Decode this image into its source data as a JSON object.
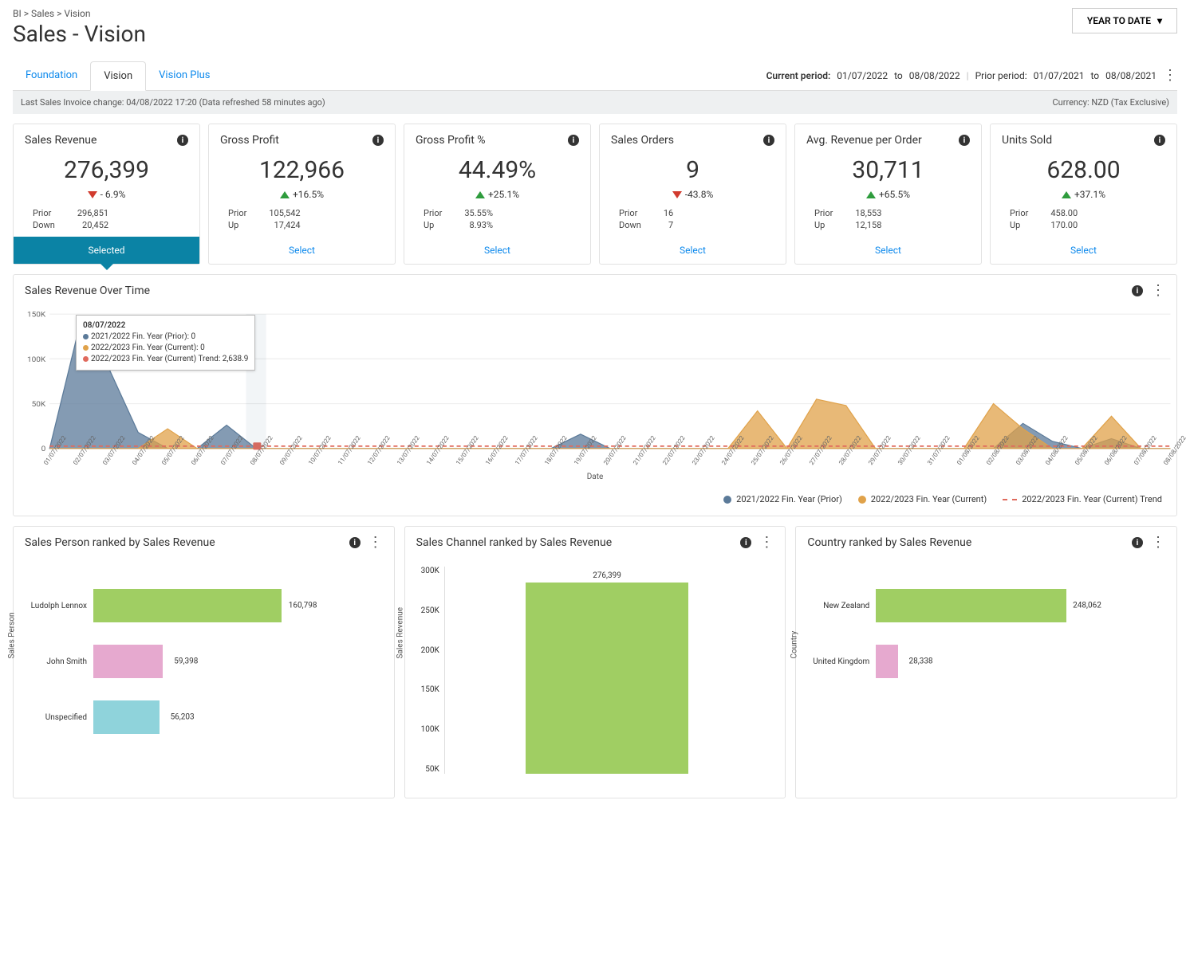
{
  "breadcrumb": "BI > Sales > Vision",
  "title": "Sales - Vision",
  "period_selector": "YEAR TO DATE",
  "tabs": [
    {
      "label": "Foundation",
      "active": false
    },
    {
      "label": "Vision",
      "active": true
    },
    {
      "label": "Vision Plus",
      "active": false
    }
  ],
  "periods": {
    "current_lbl": "Current period:",
    "current_from": "01/07/2022",
    "to_txt": "to",
    "current_to": "08/08/2022",
    "prior_lbl": "Prior period:",
    "prior_from": "01/07/2021",
    "prior_to": "08/08/2021"
  },
  "info_left": "Last Sales Invoice change: 04/08/2022 17:20 (Data refreshed 58 minutes ago)",
  "info_right": "Currency:  NZD (Tax Exclusive)",
  "kpi": [
    {
      "title": "Sales Revenue",
      "value": "276,399",
      "dir": "down",
      "chg": "- 6.9%",
      "r1l": "Prior",
      "r1v": "296,851",
      "r2l": "Down",
      "r2v": "20,452",
      "sel": "Selected",
      "selected": true
    },
    {
      "title": "Gross Profit",
      "value": "122,966",
      "dir": "up",
      "chg": "+16.5%",
      "r1l": "Prior",
      "r1v": "105,542",
      "r2l": "Up",
      "r2v": "17,424",
      "sel": "Select",
      "selected": false
    },
    {
      "title": "Gross Profit %",
      "value": "44.49%",
      "dir": "up",
      "chg": "+25.1%",
      "r1l": "Prior",
      "r1v": "35.55%",
      "r2l": "Up",
      "r2v": "8.93%",
      "sel": "Select",
      "selected": false
    },
    {
      "title": "Sales Orders",
      "value": "9",
      "dir": "down",
      "chg": "-43.8%",
      "r1l": "Prior",
      "r1v": "16",
      "r2l": "Down",
      "r2v": "7",
      "sel": "Select",
      "selected": false
    },
    {
      "title": "Avg. Revenue per Order",
      "value": "30,711",
      "dir": "up",
      "chg": "+65.5%",
      "r1l": "Prior",
      "r1v": "18,553",
      "r2l": "Up",
      "r2v": "12,158",
      "sel": "Select",
      "selected": false
    },
    {
      "title": "Units Sold",
      "value": "628.00",
      "dir": "up",
      "chg": "+37.1%",
      "r1l": "Prior",
      "r1v": "458.00",
      "r2l": "Up",
      "r2v": "170.00",
      "sel": "Select",
      "selected": false
    }
  ],
  "overtime_title": "Sales Revenue Over Time",
  "overtime_xtitle": "Date",
  "tooltip": {
    "date": "08/07/2022",
    "l1": "2021/2022 Fin. Year (Prior): 0",
    "l2": "2022/2023 Fin. Year (Current): 0",
    "l3": "2022/2023 Fin. Year (Current) Trend: 2,638.9"
  },
  "legend": {
    "prior": "2021/2022 Fin. Year (Prior)",
    "current": "2022/2023 Fin. Year (Current)",
    "trend": "2022/2023 Fin. Year (Current) Trend"
  },
  "colors": {
    "prior": "#5b7a99",
    "current": "#e0a24a",
    "trend": "#e06a5d",
    "green": "#a0ce63",
    "pink": "#e6a9cf",
    "cyan": "#8fd3db"
  },
  "panel1_title": "Sales Person ranked by Sales Revenue",
  "panel1_ytitle": "Sales Person",
  "panel2_title": "Sales Channel ranked by Sales Revenue",
  "panel2_ytitle": "Sales Revenue",
  "panel3_title": "Country ranked by Sales Revenue",
  "panel3_ytitle": "Country",
  "chart_data": [
    {
      "type": "area",
      "title": "Sales Revenue Over Time",
      "xlabel": "Date",
      "ylabel": "",
      "ylim": [
        0,
        150000
      ],
      "x": [
        "01/07/2022",
        "02/07/2022",
        "03/07/2022",
        "04/07/2022",
        "05/07/2022",
        "06/07/2022",
        "07/07/2022",
        "08/07/2022",
        "09/07/2022",
        "10/07/2022",
        "11/07/2022",
        "12/07/2022",
        "13/07/2022",
        "14/07/2022",
        "15/07/2022",
        "16/07/2022",
        "17/07/2022",
        "18/07/2022",
        "19/07/2022",
        "20/07/2022",
        "21/07/2022",
        "22/07/2022",
        "23/07/2022",
        "24/07/2022",
        "25/07/2022",
        "26/07/2022",
        "27/07/2022",
        "28/07/2022",
        "29/07/2022",
        "30/07/2022",
        "31/07/2022",
        "01/08/2022",
        "02/08/2022",
        "03/08/2022",
        "04/08/2022",
        "05/08/2022",
        "06/08/2022",
        "07/08/2022",
        "08/08/2022"
      ],
      "series": [
        {
          "name": "2021/2022 Fin. Year (Prior)",
          "values": [
            0,
            135000,
            90000,
            18000,
            0,
            0,
            26000,
            0,
            0,
            0,
            0,
            0,
            0,
            0,
            0,
            0,
            0,
            0,
            16000,
            0,
            0,
            0,
            0,
            0,
            0,
            0,
            0,
            0,
            0,
            0,
            0,
            0,
            0,
            28000,
            8000,
            0,
            11000,
            0,
            0
          ]
        },
        {
          "name": "2022/2023 Fin. Year (Current)",
          "values": [
            0,
            0,
            0,
            0,
            22000,
            0,
            0,
            0,
            0,
            0,
            0,
            0,
            0,
            0,
            0,
            0,
            0,
            0,
            0,
            0,
            0,
            0,
            0,
            0,
            42000,
            0,
            55000,
            48000,
            0,
            0,
            0,
            0,
            50000,
            22000,
            0,
            0,
            36000,
            0,
            0
          ]
        },
        {
          "name": "2022/2023 Fin. Year (Current) Trend",
          "values": [
            2639,
            2639,
            2639,
            2639,
            2639,
            2639,
            2639,
            2639,
            2639,
            2639,
            2639,
            2639,
            2639,
            2639,
            2639,
            2639,
            2639,
            2639,
            2639,
            2639,
            2639,
            2639,
            2639,
            2639,
            2639,
            2639,
            2639,
            2639,
            2639,
            2639,
            2639,
            2639,
            2639,
            2639,
            2639,
            2639,
            2639,
            2639,
            2639
          ]
        }
      ],
      "yticks": [
        "0",
        "50K",
        "100K",
        "150K"
      ]
    },
    {
      "type": "bar",
      "orientation": "horizontal",
      "title": "Sales Person ranked by Sales Revenue",
      "ylabel": "Sales Person",
      "categories": [
        "Ludolph Lennox",
        "John Smith",
        "Unspecified"
      ],
      "values": [
        160798,
        59398,
        56203
      ],
      "xlim": [
        0,
        170000
      ],
      "colors": [
        "#a0ce63",
        "#e6a9cf",
        "#8fd3db"
      ],
      "value_labels": [
        "160,798",
        "59,398",
        "56,203"
      ]
    },
    {
      "type": "bar",
      "orientation": "vertical",
      "title": "Sales Channel ranked by Sales Revenue",
      "ylabel": "Sales Revenue",
      "categories": [
        ""
      ],
      "values": [
        276399
      ],
      "ylim": [
        0,
        300000
      ],
      "yticks": [
        "50K",
        "100K",
        "150K",
        "200K",
        "250K",
        "300K"
      ],
      "value_labels": [
        "276,399"
      ],
      "colors": [
        "#a0ce63"
      ]
    },
    {
      "type": "bar",
      "orientation": "horizontal",
      "title": "Country ranked by Sales Revenue",
      "ylabel": "Country",
      "categories": [
        "New Zealand",
        "United Kingdom"
      ],
      "values": [
        248062,
        28338
      ],
      "xlim": [
        0,
        260000
      ],
      "colors": [
        "#a0ce63",
        "#e6a9cf"
      ],
      "value_labels": [
        "248,062",
        "28,338"
      ]
    }
  ]
}
